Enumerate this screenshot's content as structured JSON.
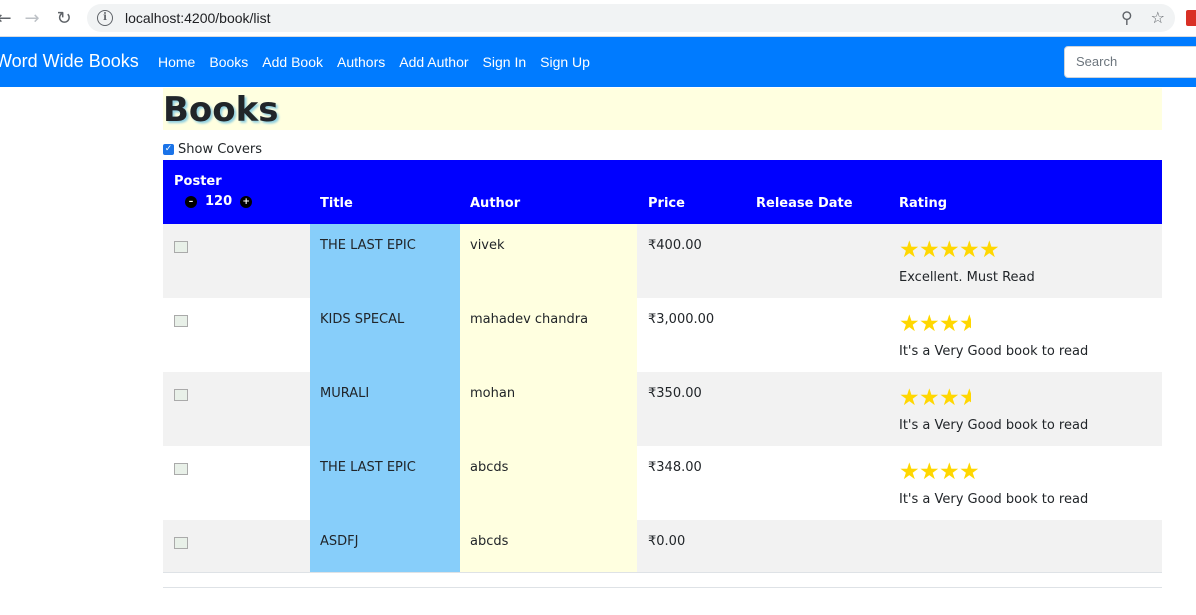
{
  "browser": {
    "url": "localhost:4200/book/list"
  },
  "navbar": {
    "brand": "Word Wide Books",
    "links": [
      "Home",
      "Books",
      "Add Book",
      "Authors",
      "Add Author",
      "Sign In",
      "Sign Up"
    ],
    "search_placeholder": "Search",
    "bg_color": "#007bff"
  },
  "page": {
    "title": "Books",
    "show_covers_label": "Show Covers",
    "show_covers_checked": true
  },
  "table": {
    "headers": {
      "poster": "Poster",
      "poster_width": "120",
      "title": "Title",
      "author": "Author",
      "price": "Price",
      "release_date": "Release Date",
      "rating": "Rating"
    },
    "rows": [
      {
        "title": "THE LAST EPIC",
        "author": "vivek",
        "price": "₹400.00",
        "release_date": "",
        "rating": 5,
        "rating_text": "Excellent. Must Read"
      },
      {
        "title": "KIDS SPECAL",
        "author": "mahadev chandra",
        "price": "₹3,000.00",
        "release_date": "",
        "rating": 3.5,
        "rating_text": "It's a Very Good book to read"
      },
      {
        "title": "MURALI",
        "author": "mohan",
        "price": "₹350.00",
        "release_date": "",
        "rating": 3.5,
        "rating_text": "It's a Very Good book to read"
      },
      {
        "title": "THE LAST EPIC",
        "author": "abcds",
        "price": "₹348.00",
        "release_date": "",
        "rating": 4,
        "rating_text": "It's a Very Good book to read"
      },
      {
        "title": "ASDFJ",
        "author": "abcds",
        "price": "₹0.00",
        "release_date": "",
        "rating": 0,
        "rating_text": ""
      }
    ]
  },
  "colors": {
    "header_bg": "#0000ff",
    "title_col": "#87cefa",
    "author_col": "#ffffe0",
    "star": "#ffd700"
  }
}
